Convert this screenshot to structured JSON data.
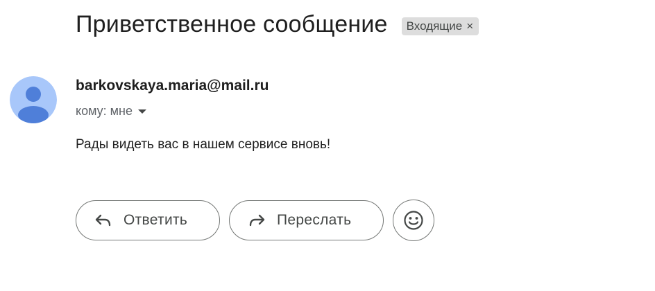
{
  "email": {
    "subject": "Приветственное сообщение",
    "label_chip": "Входящие",
    "label_chip_close": "×",
    "sender": "barkovskaya.maria@mail.ru",
    "recipient": "кому: мне",
    "body": "Рады видеть вас в нашем сервисе вновь!"
  },
  "actions": {
    "reply_label": "Ответить",
    "forward_label": "Переслать"
  },
  "icons": {
    "avatar": "person-avatar-icon",
    "recipient_dropdown": "caret-down-icon",
    "reply": "reply-arrow-icon",
    "forward": "forward-arrow-icon",
    "emoji": "smiley-emoji-icon"
  },
  "colors": {
    "avatar_background": "#a8c7fa",
    "avatar_figure": "#4f7fd9",
    "chip_background": "#dddddd",
    "button_border": "#747775"
  }
}
